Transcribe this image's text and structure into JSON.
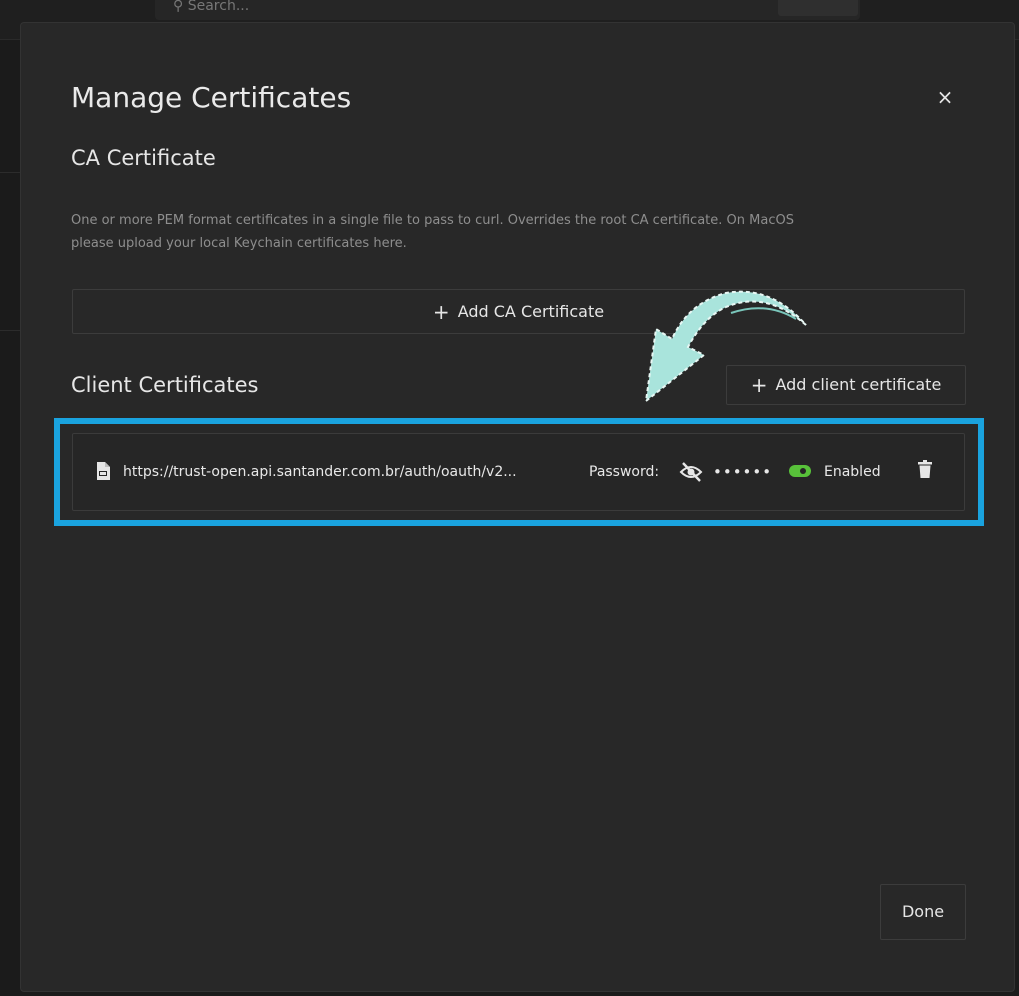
{
  "background": {
    "search_placeholder": "Search..."
  },
  "modal": {
    "title": "Manage Certificates",
    "close_glyph": "×",
    "ca_section": {
      "heading": "CA Certificate",
      "description": "One or more PEM format certificates in a single file to pass to curl. Overrides the root CA certificate. On MacOS please upload your local Keychain certificates here.",
      "add_button_plus": "+",
      "add_button_label": "Add CA Certificate"
    },
    "client_section": {
      "heading": "Client Certificates",
      "add_button_plus": "+",
      "add_button_label": "Add client certificate",
      "certificates": [
        {
          "url": "https://trust-open.api.santander.com.br/auth/oauth/v2...",
          "password_label": "Password:",
          "password_masked": "••••••",
          "enabled_label": "Enabled",
          "enabled": true
        }
      ]
    },
    "done_label": "Done"
  },
  "colors": {
    "modal_bg": "#282828",
    "highlight": "#1aa3df",
    "enabled_green": "#58c13a",
    "arrow_fill": "#a9e4dc"
  },
  "icons": [
    "close-icon",
    "plus-icon",
    "file-icon",
    "eye-off-icon",
    "toggle-on-icon",
    "trash-icon",
    "curved-arrow-annotation"
  ]
}
